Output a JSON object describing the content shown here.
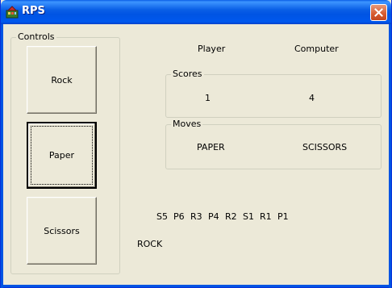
{
  "window": {
    "title": "RPS"
  },
  "controls": {
    "group_label": "Controls",
    "rock_label": "Rock",
    "paper_label": "Paper",
    "scissors_label": "Scissors"
  },
  "headers": {
    "player": "Player",
    "computer": "Computer"
  },
  "scores": {
    "group_label": "Scores",
    "player": "1",
    "computer": "4"
  },
  "moves": {
    "group_label": "Moves",
    "player": "PAPER",
    "computer": "SCISSORS"
  },
  "history": [
    "S5",
    "P6",
    "R3",
    "P4",
    "R2",
    "S1",
    "R1",
    "P1"
  ],
  "prediction": "ROCK",
  "colors": {
    "titlebar": "#0054e3",
    "background": "#ece9d8",
    "close": "#d65a2e"
  },
  "icons": {
    "app": "rps-app-icon",
    "close": "close-icon"
  }
}
